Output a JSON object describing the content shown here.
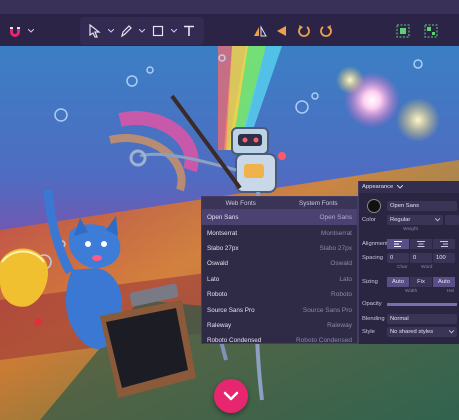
{
  "toolbar": {
    "icons": {
      "magnet": "magnet-icon",
      "pointer": "pointer-icon",
      "pen": "pen-icon",
      "rectangle": "rectangle-icon",
      "text": "text-icon",
      "flip_h": "flip-horizontal-icon",
      "flip_v": "flip-vertical-icon",
      "rotate_ccw": "rotate-ccw-icon",
      "rotate_cw": "rotate-cw-icon",
      "group": "group-icon",
      "ungroup": "ungroup-icon"
    }
  },
  "fonts_panel": {
    "tabs": [
      "Web Fonts",
      "System Fonts"
    ],
    "fonts": [
      {
        "name": "Open Sans",
        "preview": "Open Sans",
        "selected": true
      },
      {
        "name": "Montserrat",
        "preview": "Montserrat",
        "selected": false
      },
      {
        "name": "Slabo 27px",
        "preview": "Slabo 27px",
        "selected": false
      },
      {
        "name": "Oswald",
        "preview": "Oswald",
        "selected": false
      },
      {
        "name": "Lato",
        "preview": "Lato",
        "selected": false
      },
      {
        "name": "Roboto",
        "preview": "Roboto",
        "selected": false
      },
      {
        "name": "Source Sans Pro",
        "preview": "Source Sans Pro",
        "selected": false
      },
      {
        "name": "Raleway",
        "preview": "Raleway",
        "selected": false
      },
      {
        "name": "Roboto Condensed",
        "preview": "Roboto Condensed",
        "selected": false
      }
    ]
  },
  "appearance_panel": {
    "title": "Appearance",
    "font_value": "Open Sans",
    "color_label": "Color",
    "weight_value": "Regular",
    "weight_sub": "Weight",
    "alignment_label": "Alignment",
    "spacing_label": "Spacing",
    "spacing_values": [
      "0",
      "0",
      "100"
    ],
    "spacing_subs": [
      "Char",
      "Word"
    ],
    "sizing_label": "Sizing",
    "sizing_options": [
      "Auto",
      "Fix",
      "Auto"
    ],
    "sizing_subs": [
      "Width",
      "Hei"
    ],
    "opacity_label": "Opacity",
    "blending_label": "Blending",
    "blending_value": "Normal",
    "style_label": "Style",
    "style_value": "No shared styles"
  },
  "colors": {
    "accent": "#e8266f",
    "panel": "#2f2a46",
    "selected_row": "#4b4272"
  }
}
